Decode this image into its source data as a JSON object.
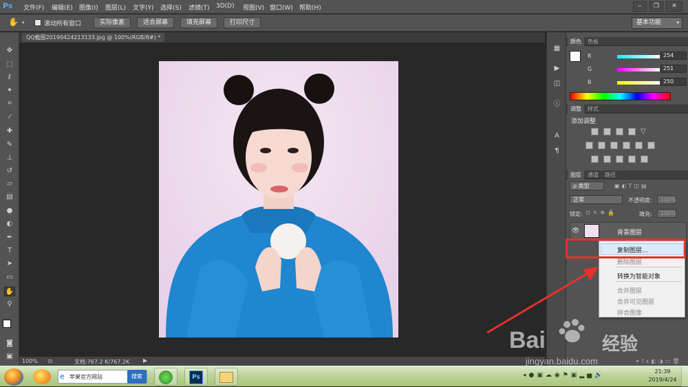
{
  "app": {
    "logo": "Ps",
    "menu": [
      "文件(F)",
      "编辑(E)",
      "图像(I)",
      "图层(L)",
      "文字(Y)",
      "选择(S)",
      "滤镜(T)",
      "3D(D)",
      "视图(V)",
      "窗口(W)",
      "帮助(H)"
    ],
    "window_controls": [
      "minimize-icon",
      "restore-icon",
      "close-icon"
    ]
  },
  "options_bar": {
    "tool_icon": "hand-icon",
    "scroll_all_checkbox_label": "滚动所有窗口",
    "scroll_all_checked": false,
    "buttons": [
      "实际像素",
      "适合屏幕",
      "填充屏幕",
      "打印尺寸"
    ],
    "workspace": "基本功能"
  },
  "toolbar": {
    "tools": [
      "move-icon",
      "marquee-icon",
      "lasso-icon",
      "magic-wand-icon",
      "crop-icon",
      "eyedropper-icon",
      "healing-brush-icon",
      "brush-icon",
      "clone-stamp-icon",
      "history-brush-icon",
      "eraser-icon",
      "gradient-icon",
      "blur-icon",
      "dodge-icon",
      "pen-icon",
      "type-icon",
      "path-select-icon",
      "rectangle-icon",
      "hand-icon",
      "zoom-icon"
    ],
    "active_tool": "hand-icon"
  },
  "document": {
    "tab_title": "QQ截图20190424213133.jpg @ 100%(RGB/8#) *",
    "zoom": "100%",
    "doc_size": "文档:767.2 K/767.2K"
  },
  "color_panel": {
    "tabs": [
      "颜色",
      "色板"
    ],
    "active_tab": "颜色",
    "channels": [
      {
        "label": "R",
        "value": "254",
        "color": "#ff0000"
      },
      {
        "label": "G",
        "value": "251",
        "color": "#00ff00"
      },
      {
        "label": "B",
        "value": "250",
        "color": "#0000ff"
      }
    ],
    "foreground_color": "#fefbfa"
  },
  "adjustments_panel": {
    "tabs": [
      "调整",
      "样式"
    ],
    "active_tab": "调整",
    "title": "添加调整"
  },
  "layers_panel": {
    "tabs": [
      "图层",
      "通道",
      "路径"
    ],
    "active_tab": "图层",
    "filter_kind": "ρ 类型",
    "blend_mode": "正常",
    "opacity_label": "不透明度:",
    "opacity_value": "100%",
    "lock_label": "锁定:",
    "fill_label": "填充:",
    "fill_value": "100%",
    "layer_name": "背景图层"
  },
  "context_menu": {
    "items": [
      {
        "label": "复制图层...",
        "enabled": true,
        "highlighted": true
      },
      {
        "label": "删除图层",
        "enabled": false
      },
      {
        "label": "转换为智能对象",
        "enabled": true
      },
      {
        "label": "合并图层",
        "enabled": false
      },
      {
        "label": "合并可见图层",
        "enabled": false
      },
      {
        "label": "拼合图像",
        "enabled": false
      }
    ]
  },
  "annotation": {
    "highlight_color": "#e8302d"
  },
  "watermark": {
    "brand_prefix": "Bai",
    "brand_suffix": "经验",
    "url": "jingyan.baidu.com"
  },
  "taskbar": {
    "search_text": "苹果官方网站",
    "search_button": "搜索",
    "apps": [
      "ie-icon",
      "photoshop-icon",
      "folder-icon"
    ],
    "time": "21:39",
    "date": "2019/4/24"
  }
}
